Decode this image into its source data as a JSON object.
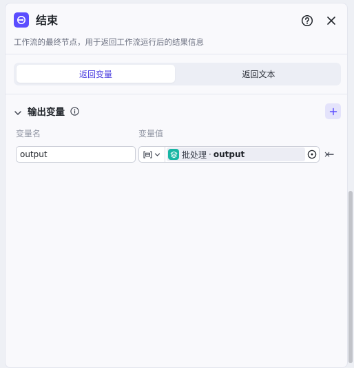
{
  "node": {
    "title": "结束",
    "description": "工作流的最终节点，用于返回工作流运行后的结果信息",
    "accent_color": "#5b4dff",
    "icon": "end-node-icon"
  },
  "header_actions": {
    "help_icon": "question-circle-icon",
    "close_icon": "close-icon"
  },
  "tabs": [
    {
      "label": "返回变量",
      "active": true
    },
    {
      "label": "返回文本",
      "active": false
    }
  ],
  "output_section": {
    "title": "输出变量",
    "info_icon": "info-icon",
    "add_icon": "plus-icon",
    "columns": {
      "name": "变量名",
      "value": "变量值"
    },
    "rows": [
      {
        "name": "output",
        "type_icon": "array-type-icon",
        "ref_node": "批处理",
        "ref_separator": "·",
        "ref_field": "output",
        "ref_color": "#18b6a4"
      }
    ]
  }
}
